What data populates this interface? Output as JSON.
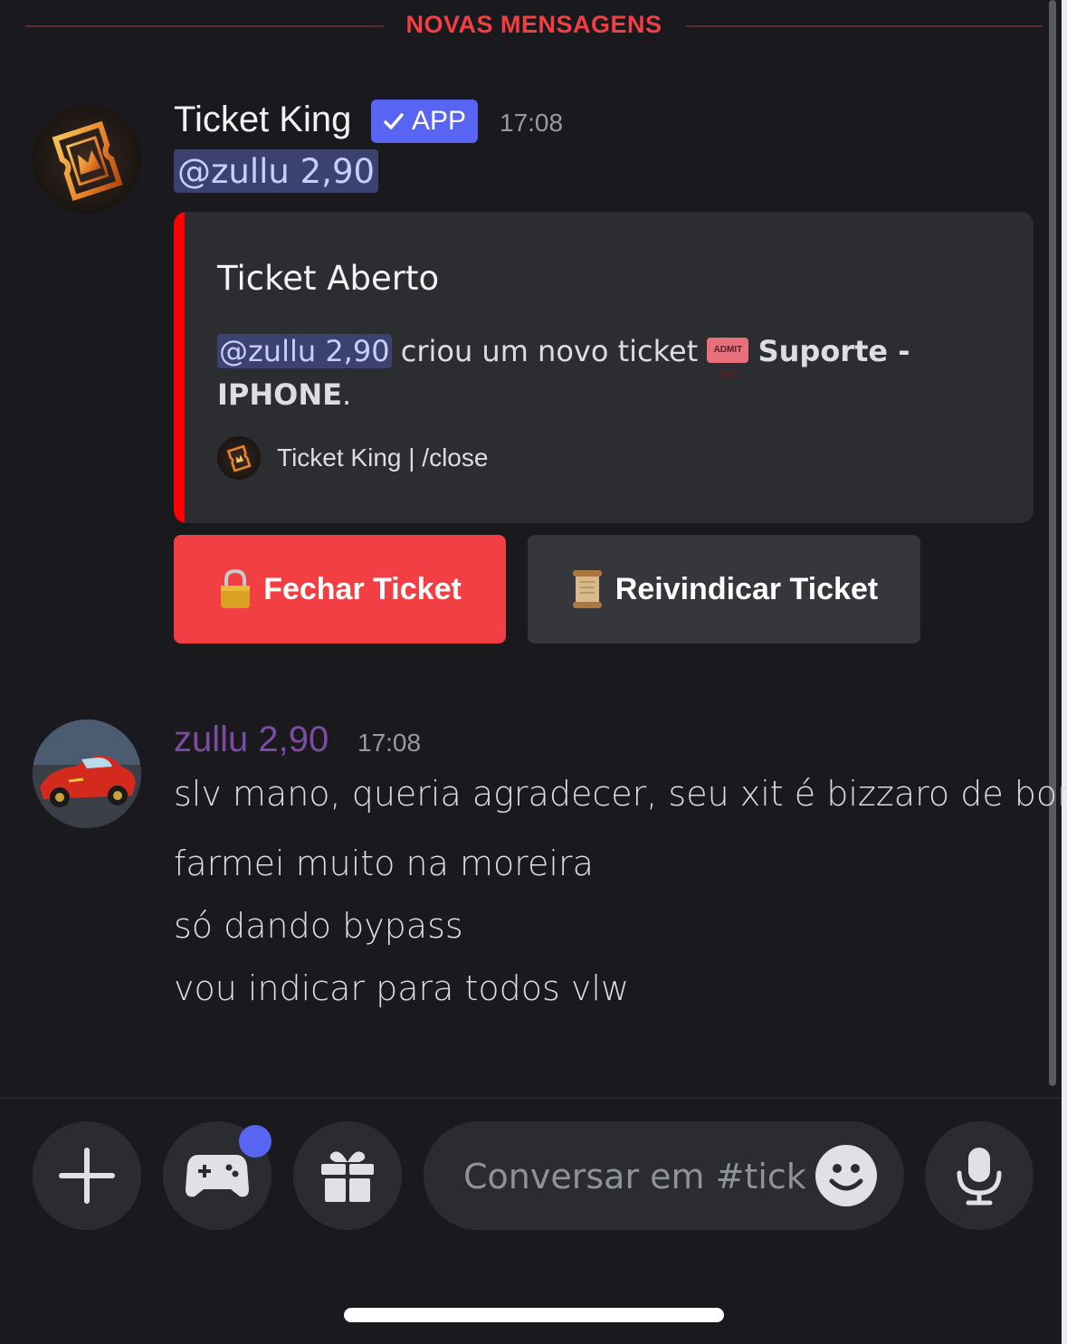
{
  "divider": {
    "label": "NOVAS MENSAGENS"
  },
  "bot_message": {
    "author": "Ticket King",
    "app_tag": "APP",
    "time": "17:08",
    "mention": "@zullu 2,90",
    "embed": {
      "accent_color": "#ff0000",
      "title": "Ticket Aberto",
      "mention": "@zullu 2,90",
      "text_before": " criou um novo ticket ",
      "ticket_emoji": "ADMIT ONE",
      "bold_text": "Suporte - IPHONE",
      "text_after": ".",
      "footer": "Ticket King | /close"
    },
    "buttons": {
      "close_label": "Fechar Ticket",
      "claim_label": "Reivindicar Ticket"
    }
  },
  "user_message": {
    "author": "zullu 2,90",
    "time": "17:08",
    "lines": [
      "slv mano, queria agradecer, seu xit é bizzaro de bom",
      "farmei muito na moreira",
      "só dando bypass",
      "vou indicar para todos vlw"
    ]
  },
  "composer": {
    "placeholder": "Conversar em #tick..."
  },
  "colors": {
    "background": "#1a1a1e",
    "danger": "#f23f43",
    "blurple": "#5865f2",
    "user_name": "#7d4ba1"
  }
}
